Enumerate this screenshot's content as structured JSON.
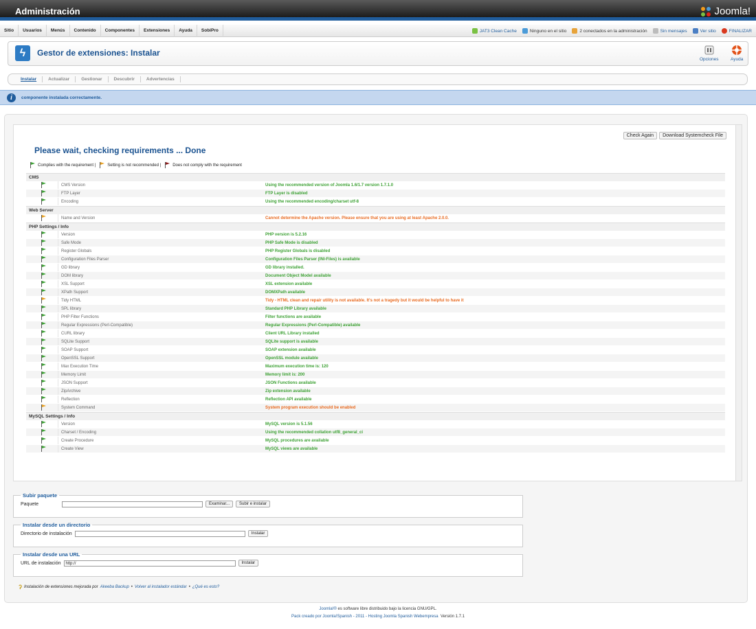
{
  "header": {
    "title": "Administración",
    "brand": "Joomla!"
  },
  "menu": {
    "items": [
      "Sitio",
      "Usuarios",
      "Menús",
      "Contenido",
      "Componentes",
      "Extensiones",
      "Ayuda",
      "SobiPro"
    ]
  },
  "status": {
    "cache": "JAT3 Clean Cache",
    "site_users": "Ninguno en el sitio",
    "admin_users": "2 conectados en la administración",
    "messages": "Sin mensajes",
    "view_site": "Ver sitio",
    "logout": "FINALIZAR"
  },
  "toolbar": {
    "title": "Gestor de extensiones: Instalar",
    "options": "Opciones",
    "help": "Ayuda"
  },
  "submenu": {
    "items": [
      "Instalar",
      "Actualizar",
      "Gestionar",
      "Descubrir",
      "Advertencias"
    ]
  },
  "message": "componente instalada correctamente.",
  "check": {
    "title": "Please wait, checking requirements ... Done",
    "check_again": "Check Again",
    "download": "Download Systemcheck File",
    "legend_ok": "Complies with the requirement |",
    "legend_warn": "Setting is not recommended |",
    "legend_fail": "Does not comply with the requirement"
  },
  "requirements": [
    {
      "section": "CMS",
      "rows": [
        {
          "name": "CMS Version",
          "value": "Using the recommended version of Joomla 1.6/1.7 version 1.7.1.0",
          "status": "ok"
        },
        {
          "name": "FTP Layer",
          "value": "FTP Layer is disabled",
          "status": "ok"
        },
        {
          "name": "Encoding",
          "value": "Using the recommended encoding/charset utf-8",
          "status": "ok"
        }
      ]
    },
    {
      "section": "Web Server",
      "rows": [
        {
          "name": "Name and Version",
          "value": "Cannot determine the Apache version. Please ensure that you are using at least Apache 2.0.0.",
          "status": "warn"
        }
      ]
    },
    {
      "section": "PHP Settings / Info",
      "rows": [
        {
          "name": "Version",
          "value": "PHP version is 5.2.16",
          "status": "ok"
        },
        {
          "name": "Safe Mode",
          "value": "PHP Safe Mode is disabled",
          "status": "ok"
        },
        {
          "name": "Register Globals",
          "value": "PHP Register Globals is disabled",
          "status": "ok"
        },
        {
          "name": "Configuration Files Parser",
          "value": "Configuration Files Parser (INI-Files) is available",
          "status": "ok"
        },
        {
          "name": "GD library",
          "value": "GD library installed.",
          "status": "ok"
        },
        {
          "name": "DOM library",
          "value": "Document Object Model available",
          "status": "ok"
        },
        {
          "name": "XSL Support",
          "value": "XSL extension available",
          "status": "ok"
        },
        {
          "name": "XPath Support",
          "value": "DOMXPath available",
          "status": "ok"
        },
        {
          "name": "Tidy HTML",
          "value": "Tidy - HTML clean and repair utility is not available. It's not a tragedy but it would be helpful to have it",
          "status": "warn"
        },
        {
          "name": "SPL library",
          "value": "Standard PHP Library available",
          "status": "ok"
        },
        {
          "name": "PHP Filter Functions",
          "value": "Filter functions are available",
          "status": "ok"
        },
        {
          "name": "Regular Expressions (Perl-Compatible)",
          "value": "Regular Expressions (Perl-Compatible) available",
          "status": "ok"
        },
        {
          "name": "CURL library",
          "value": "Client URL Library installed",
          "status": "ok"
        },
        {
          "name": "SQLite Support",
          "value": "SQLite support is available",
          "status": "ok"
        },
        {
          "name": "SOAP Support",
          "value": "SOAP extension available",
          "status": "ok"
        },
        {
          "name": "OpenSSL Support",
          "value": "OpenSSL module available",
          "status": "ok"
        },
        {
          "name": "Max Execution Time",
          "value": "Maximum execution time is: 120",
          "status": "ok"
        },
        {
          "name": "Memory Limit",
          "value": "Memory limit is: 200",
          "status": "ok"
        },
        {
          "name": "JSON Support",
          "value": "JSON Functions available",
          "status": "ok"
        },
        {
          "name": "ZipArchive",
          "value": "Zip extension available",
          "status": "ok"
        },
        {
          "name": "Reflection",
          "value": "Reflection API available",
          "status": "ok"
        },
        {
          "name": "System Command",
          "value": "System program execution should be enabled",
          "status": "warn"
        }
      ]
    },
    {
      "section": "MySQL Settings / Info",
      "rows": [
        {
          "name": "Version",
          "value": "MySQL version is 5.1.56",
          "status": "ok"
        },
        {
          "name": "Charset / Encoding",
          "value": "Using the recommended collation utf8_general_ci",
          "status": "ok"
        },
        {
          "name": "Create Procedure",
          "value": "MySQL procedures are available",
          "status": "ok"
        },
        {
          "name": "Create View",
          "value": "MySQL views are available",
          "status": "ok"
        }
      ]
    }
  ],
  "upload": {
    "legend": "Subir paquete",
    "label": "Paquete",
    "browse": "Examinar...",
    "submit": "Subir e instalar"
  },
  "directory": {
    "legend": "Instalar desde un directorio",
    "label": "Directorio de instalación",
    "submit": "Instalar"
  },
  "url": {
    "legend": "Instalar desde una URL",
    "label": "URL de instalación",
    "value": "http://",
    "submit": "Instalar"
  },
  "note": {
    "prefix": "Instalación de extensiones mejorada por",
    "akeeba": "Akeeba Backup",
    "sep1": "•",
    "revert": "Volver al instalador estándar",
    "sep2": "•",
    "what": "¿Qué es esto?"
  },
  "footer": {
    "line1_link": "Joomla!®",
    "line1": "es software libre distribuido bajo la licencia GNU/GPL.",
    "line2": "Pack creado por Joomla!Spanish - 2011 - Hosting Joomla Spanish Webempresa",
    "version": "Versión 1.7.1"
  },
  "colors": {
    "ok": "#3da134",
    "warn": "#e86a20",
    "accent": "#1f5c9c"
  }
}
